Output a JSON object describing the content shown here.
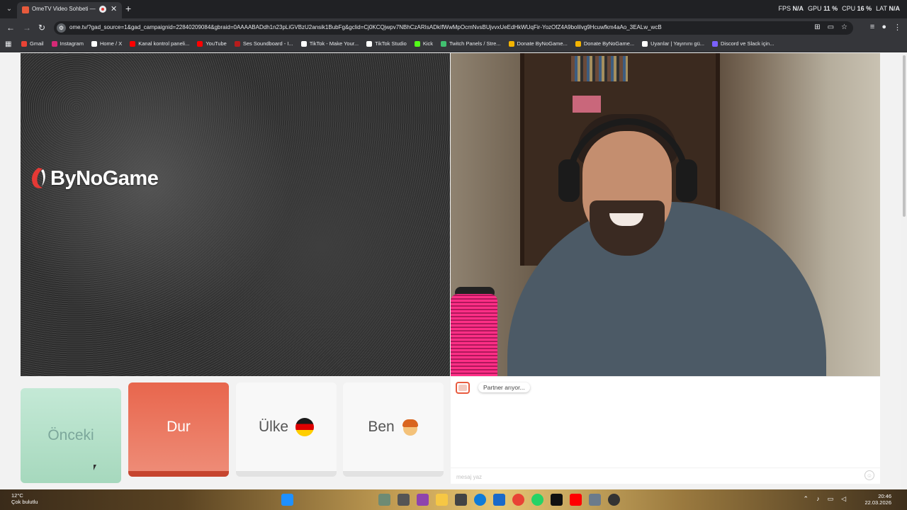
{
  "browser": {
    "tab_title": "OmeTV Video Sohbeti — O",
    "url": "ome.tv/?gad_source=1&gad_campaignid=22840209084&gbraid=0AAAABADdh1n23pLiGVBzU2ansik1BubFg&gclid=Cj0KCQjwpv7NBhCzARIsADkIfWwMpOcmNvsBUjvvxUeEdHkWUqFir-YozOfZ4A9bolilvg9Hcuwfkm4aAo_3EALw_wcB",
    "perf": {
      "fps_label": "FPS",
      "fps_value": "N/A",
      "gpu_label": "GPU",
      "gpu_value": "11 %",
      "cpu_label": "CPU",
      "cpu_value": "16 %",
      "lat_label": "LAT",
      "lat_value": "N/A"
    },
    "bookmarks": [
      {
        "label": "Gmail",
        "color": "#ea4335"
      },
      {
        "label": "Instagram",
        "color": "#d62976"
      },
      {
        "label": "Home / X",
        "color": "#ffffff"
      },
      {
        "label": "Kanal kontrol paneli...",
        "color": "#ff0000"
      },
      {
        "label": "YouTube",
        "color": "#ff0000"
      },
      {
        "label": "Ses Soundboard - I...",
        "color": "#b71c1c"
      },
      {
        "label": "TikTok - Make Your...",
        "color": "#ffffff"
      },
      {
        "label": "TikTok Studio",
        "color": "#ffffff"
      },
      {
        "label": "Kick",
        "color": "#53fc18"
      },
      {
        "label": "Twitch Panels / Stre...",
        "color": "#41c070"
      },
      {
        "label": "Donate ByNoGame...",
        "color": "#f4b400"
      },
      {
        "label": "Donate ByNoGame...",
        "color": "#f4b400"
      },
      {
        "label": "Uyarılar | Yayınını gü...",
        "color": "#ffffff"
      },
      {
        "label": "Discord ve Slack için...",
        "color": "#7b61ff"
      }
    ]
  },
  "overlay": {
    "logo_text": "ByNoGame"
  },
  "controls": {
    "prev_label": "Önceki",
    "stop_label": "Dur",
    "country_label": "Ülke",
    "me_label": "Ben"
  },
  "chat": {
    "status_message": "Partner arıyor...",
    "input_placeholder": "mesaj yaz"
  },
  "taskbar": {
    "temperature": "12°C",
    "weather": "Çok bulutlu",
    "time": "20:46",
    "date": "22.03.2026"
  },
  "colors": {
    "stop_button": "#e8664d",
    "prev_button": "#b5e0c9",
    "highlight_light": "#ff2f86"
  }
}
